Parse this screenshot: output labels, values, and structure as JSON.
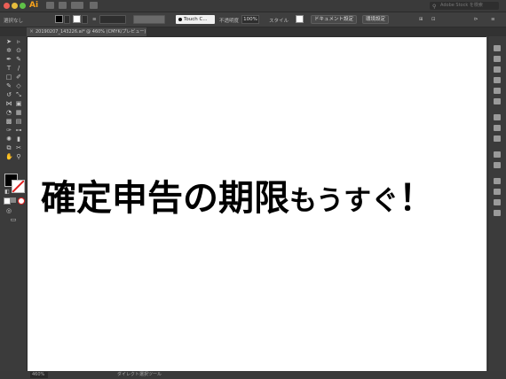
{
  "app": {
    "logo": "Ai"
  },
  "search": {
    "placeholder": "Adobe Stock を検索"
  },
  "control_bar": {
    "selection_label": "選択なし",
    "brush_name": "Touch C...",
    "opacity_label": "不透明度",
    "opacity_value": "100%",
    "style_label": "スタイル",
    "doc_setup_button": "ドキュメント設定",
    "prefs_button": "環境設定"
  },
  "tab": {
    "title": "20190207_143226.ai* @ 460% (CMYK/プレビュー)"
  },
  "artboard": {
    "headline_big": "確定申告の期限",
    "headline_small": "もうすぐ",
    "headline_end": "！"
  },
  "status": {
    "zoom": "460%",
    "tool_hint": "ダイレクト選択ツール"
  },
  "colors": {
    "fill": "#000000",
    "stroke_none_slash": "#e02020",
    "logo": "#f7a21b"
  }
}
